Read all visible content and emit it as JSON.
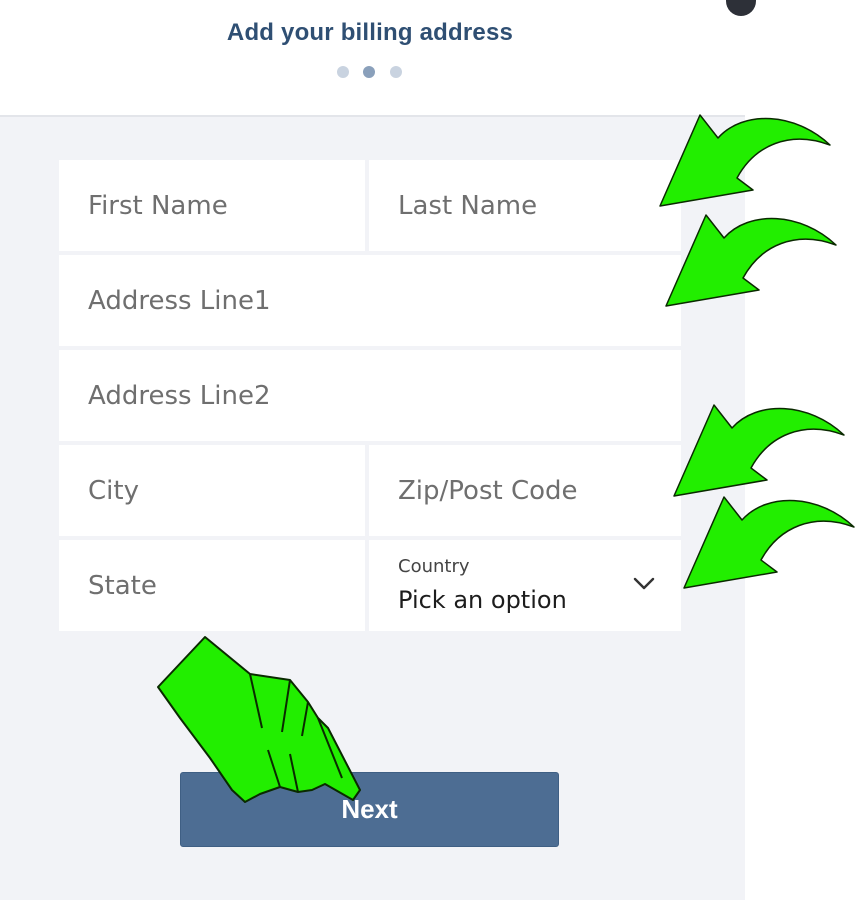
{
  "header": {
    "title": "Add your billing address",
    "steps": {
      "total": 3,
      "current": 2
    }
  },
  "form": {
    "first_name_placeholder": "First Name",
    "last_name_placeholder": "Last Name",
    "address1_placeholder": "Address Line1",
    "address2_placeholder": "Address Line2",
    "city_placeholder": "City",
    "zip_placeholder": "Zip/Post Code",
    "state_placeholder": "State",
    "country_label": "Country",
    "country_value": "Pick an option"
  },
  "actions": {
    "next_label": "Next"
  },
  "annotations": {
    "arrow_color": "#22ee00",
    "arrow_outline": "#0a2a00",
    "arrow_icon": "curved-arrow-icon",
    "hand_icon": "pointing-hand-icon"
  },
  "colors": {
    "title": "#2f4f73",
    "button": "#4d6d93",
    "panel_bg": "#f2f3f7"
  }
}
